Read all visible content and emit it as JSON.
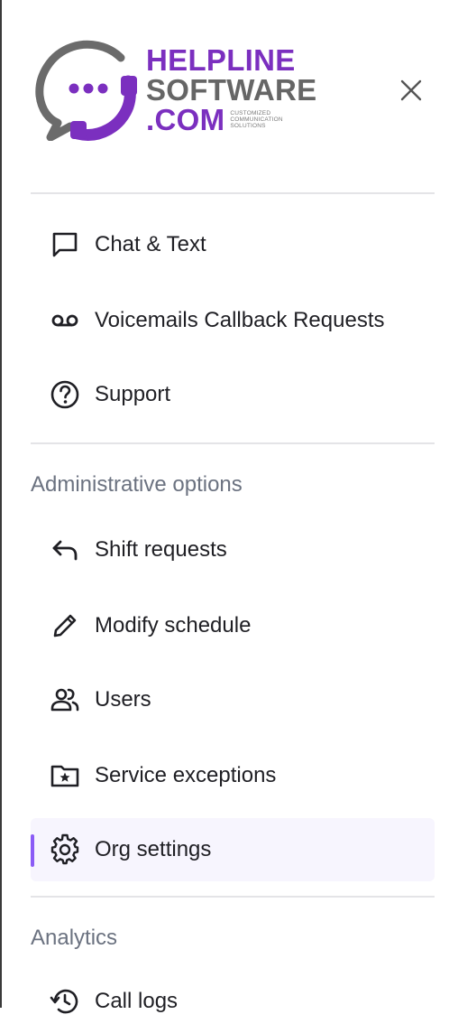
{
  "brand": {
    "line1": "HELPLINE",
    "line2": "SOFTWARE",
    "line3": ".COM",
    "tagline": [
      "CUSTOMIZED",
      "COMMUNICATION",
      "SOLUTIONS"
    ],
    "primary_color": "#7b2fbf",
    "secondary_color": "#666666"
  },
  "header": {
    "close_icon": "close-icon"
  },
  "nav": {
    "main_items": [
      {
        "label": "Chat & Text",
        "icon": "chat-icon"
      },
      {
        "label": "Voicemails Callback Requests",
        "icon": "voicemail-icon"
      },
      {
        "label": "Support",
        "icon": "help-circle-icon"
      }
    ],
    "admin_section": {
      "title": "Administrative options",
      "items": [
        {
          "label": "Shift requests",
          "icon": "reply-arrow-icon"
        },
        {
          "label": "Modify schedule",
          "icon": "pencil-icon"
        },
        {
          "label": "Users",
          "icon": "users-icon"
        },
        {
          "label": "Service exceptions",
          "icon": "folder-star-icon"
        },
        {
          "label": "Org settings",
          "icon": "gear-icon",
          "active": true
        }
      ]
    },
    "analytics_section": {
      "title": "Analytics",
      "items": [
        {
          "label": "Call logs",
          "icon": "history-icon"
        }
      ]
    }
  },
  "colors": {
    "active_bg": "#f7f5fe",
    "active_indicator": "#8b5cf6",
    "text": "#1f1f24",
    "section_text": "#6b7280"
  }
}
